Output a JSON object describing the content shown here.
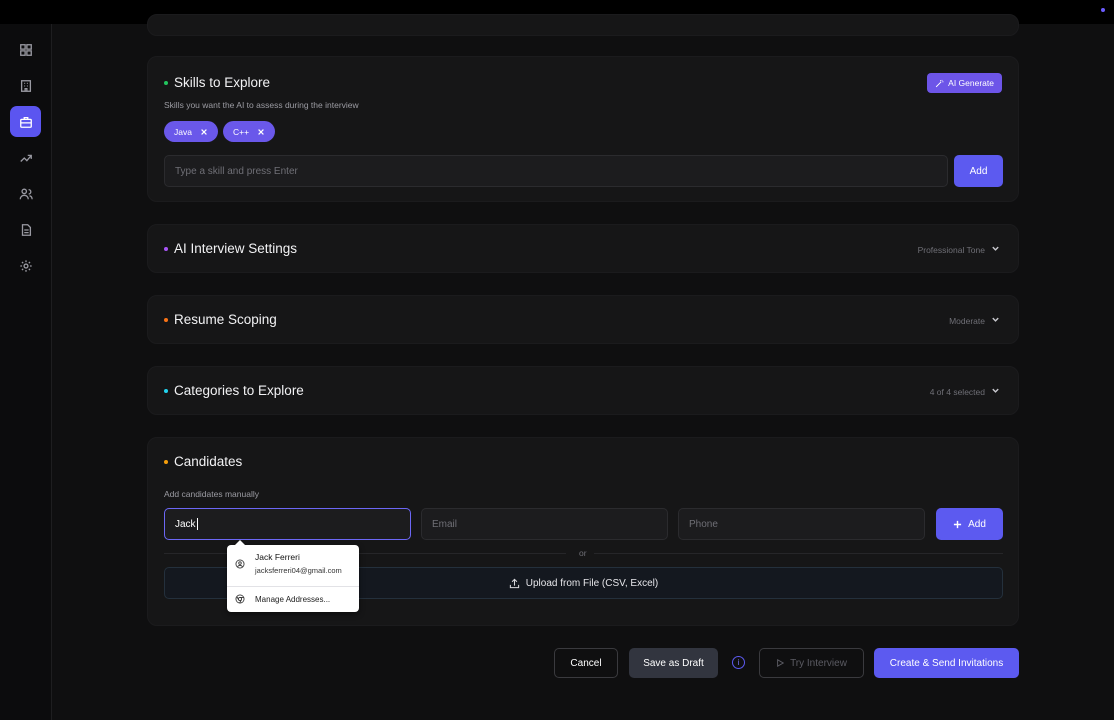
{
  "skills": {
    "title": "Skills to Explore",
    "subtitle": "Skills you want the AI to assess during the interview",
    "ai_generate_label": "AI Generate",
    "chips": [
      {
        "label": "Java"
      },
      {
        "label": "C++"
      }
    ],
    "input_placeholder": "Type a skill and press Enter",
    "add_label": "Add",
    "bullet_color": "#22c55e"
  },
  "ai_settings": {
    "title": "AI Interview Settings",
    "value": "Professional Tone",
    "bullet_color": "#a855f7"
  },
  "resume": {
    "title": "Resume Scoping",
    "value": "Moderate",
    "bullet_color": "#f97316"
  },
  "categories": {
    "title": "Categories to Explore",
    "value": "4 of 4 selected",
    "bullet_color": "#22d3ee"
  },
  "candidates": {
    "title": "Candidates",
    "subtitle": "Add candidates manually",
    "name_value": "Jack",
    "email_placeholder": "Email",
    "phone_placeholder": "Phone",
    "add_label": "Add",
    "or_label": "or",
    "upload_label": "Upload from File (CSV, Excel)",
    "bullet_color": "#f59e0b"
  },
  "autofill": {
    "suggestion_name": "Jack Ferreri",
    "suggestion_email": "jacksferreri04@gmail.com",
    "manage_label": "Manage Addresses..."
  },
  "footer": {
    "cancel_label": "Cancel",
    "save_draft_label": "Save as Draft",
    "try_interview_label": "Try Interview",
    "create_label": "Create & Send Invitations"
  },
  "colors": {
    "accent": "#5c5af0",
    "background": "#0f0f10",
    "card": "#161617"
  },
  "sidebar": {
    "items": [
      {
        "icon": "dashboard-icon"
      },
      {
        "icon": "building-icon"
      },
      {
        "icon": "briefcase-icon",
        "active": true
      },
      {
        "icon": "trending-icon"
      },
      {
        "icon": "users-icon"
      },
      {
        "icon": "document-icon"
      },
      {
        "icon": "settings-icon"
      }
    ]
  }
}
